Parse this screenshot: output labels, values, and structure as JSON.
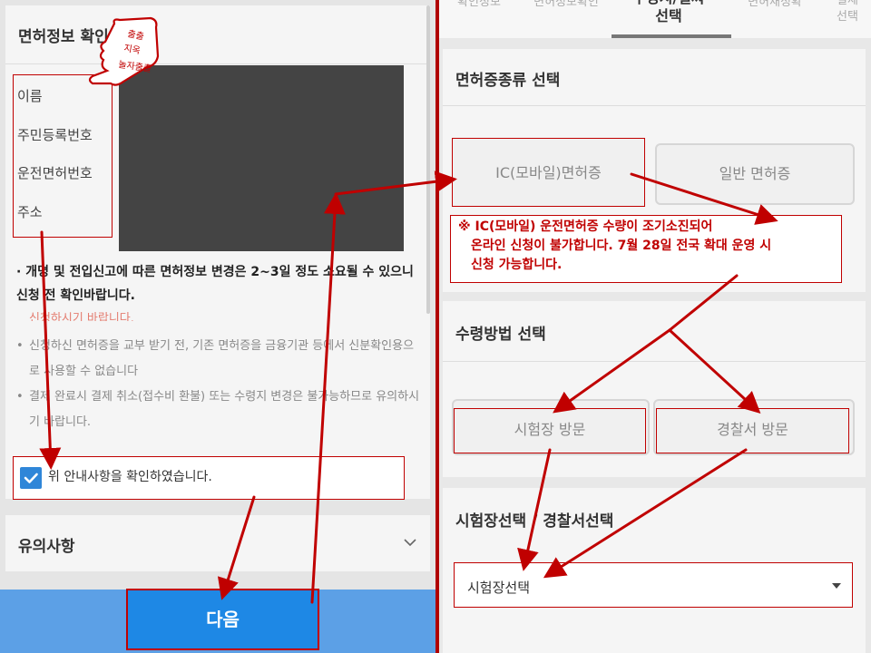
{
  "left": {
    "title": "면허정보 확인",
    "fields": [
      "이름",
      "주민등록번호",
      "운전면허번호",
      "주소"
    ],
    "notice_main": "· 개명 및 전입신고에 따른 면허정보 변경은 2~3일 정도 소요될 수 있으니 신청 전 확인바랍니다.",
    "notice_red_fragment": "신청하시기 바랍니다.",
    "notices": [
      "신청하신 면허증을 교부 받기 전, 기존 면허증을 금융기관 등에서 신분확인용으로 사용할 수 없습니다",
      "결제 완료시 결제 취소(접수비 환불) 또는 수령지 변경은 불가능하므로 유의하시기 바랍니다."
    ],
    "confirm_label": "위 안내사항을 확인하였습니다.",
    "confirm_checked": true,
    "caution_title": "유의사항",
    "next_button": "다음",
    "stamp_lines": [
      "출출",
      "지옥",
      "놀자출출"
    ]
  },
  "right": {
    "tabs": [
      "확인정보",
      "면허정보확인",
      "수령지/결짜\n선택",
      "면허재정확",
      "결제\n선택"
    ],
    "active_tab": "수령지/결짜\n선택",
    "license_section": {
      "title": "면허증종류 선택",
      "options": [
        "IC(모바일)면허증",
        "일반 면허증"
      ]
    },
    "ic_note": [
      "※ IC(모바일) 운전면허증 수량이 조기소진되어",
      "온라인 신청이 불가합니다. 7월 28일 전국 확대 운영 시",
      "신청 가능합니다."
    ],
    "receive_section": {
      "title": "수령방법 선택",
      "options": [
        "시험장 방문",
        "경찰서 방문"
      ]
    },
    "center_section": {
      "title": "시험장선택 / 경찰서선택",
      "select_value": "시험장선택"
    }
  },
  "colors": {
    "annotation_red": "#c00000",
    "primary_blue": "#1e88e5",
    "next_bar_blue": "#5ca0e6",
    "photo_gray": "#444444"
  }
}
